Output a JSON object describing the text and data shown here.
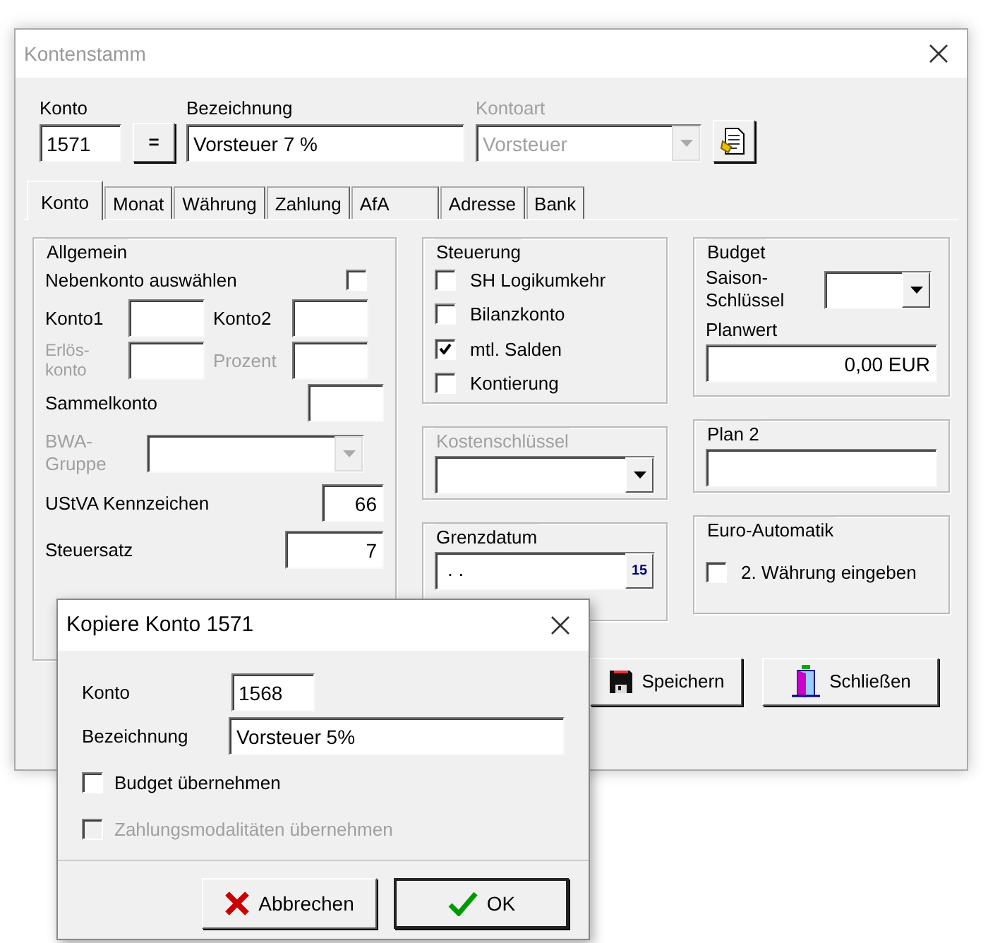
{
  "window": {
    "title": "Kontenstamm"
  },
  "header": {
    "konto": {
      "label": "Konto",
      "value": "1571"
    },
    "equals_button": "=",
    "bezeichnung": {
      "label": "Bezeichnung",
      "value": "Vorsteuer 7 %"
    },
    "kontoart": {
      "label": "Kontoart",
      "value": "Vorsteuer",
      "disabled": true
    }
  },
  "tabs": [
    {
      "label": "Konto",
      "selected": true
    },
    {
      "label": "Monat",
      "selected": false
    },
    {
      "label": "Währung",
      "selected": false
    },
    {
      "label": "Zahlung",
      "selected": false
    },
    {
      "label": "AfA",
      "selected": false
    },
    {
      "label": "Adresse",
      "selected": false
    },
    {
      "label": "Bank",
      "selected": false
    }
  ],
  "allgemein": {
    "title": "Allgemein",
    "nebenkonto": {
      "label": "Nebenkonto auswählen",
      "checked": false
    },
    "konto1": {
      "label": "Konto1",
      "disabled": false
    },
    "konto2": {
      "label": "Konto2",
      "disabled": false
    },
    "erloeskonto": {
      "label": "Erlös-konto",
      "disabled": true
    },
    "prozent": {
      "label": "Prozent",
      "disabled": true
    },
    "sammelkonto": {
      "label": "Sammelkonto"
    },
    "bwa_gruppe": {
      "label": "BWA-Gruppe",
      "disabled": true
    },
    "ustva": {
      "label": "UStVA Kennzeichen",
      "value": "66"
    },
    "steuersatz": {
      "label": "Steuersatz",
      "value": "7"
    }
  },
  "steuerung": {
    "title": "Steuerung",
    "options": [
      {
        "label": "SH Logikumkehr",
        "checked": false
      },
      {
        "label": "Bilanzkonto",
        "checked": false
      },
      {
        "label": "mtl. Salden",
        "checked": true
      },
      {
        "label": "Kontierung",
        "checked": false
      }
    ]
  },
  "budget": {
    "title": "Budget",
    "saison_label": "Saison-Schlüssel",
    "planwert_label": "Planwert",
    "planwert": "0,00 EUR"
  },
  "kostenschluessel": {
    "title": "Kostenschlüssel",
    "disabled": true
  },
  "plan2": {
    "title": "Plan 2"
  },
  "grenzdatum": {
    "title": "Grenzdatum",
    "value": ". .",
    "calendar_button": "15"
  },
  "euro_automatik": {
    "title": "Euro-Automatik",
    "option": {
      "label": "2. Währung eingeben",
      "checked": false
    }
  },
  "buttons": [
    {
      "kind": "save",
      "label": "Speichern"
    },
    {
      "kind": "close",
      "label": "Schließen"
    }
  ],
  "dialog": {
    "title": "Kopiere Konto 1571",
    "konto": {
      "label": "Konto",
      "value": "1568"
    },
    "bezeichnung": {
      "label": "Bezeichnung",
      "value": "Vorsteuer 5%"
    },
    "options": [
      {
        "label": "Budget übernehmen",
        "checked": false,
        "disabled": false
      },
      {
        "label": "Zahlungsmodalitäten übernehmen",
        "checked": false,
        "disabled": true
      }
    ],
    "buttons": [
      {
        "kind": "cancel",
        "label": "Abbrechen",
        "default": false
      },
      {
        "kind": "ok",
        "label": "OK",
        "default": true
      }
    ]
  }
}
